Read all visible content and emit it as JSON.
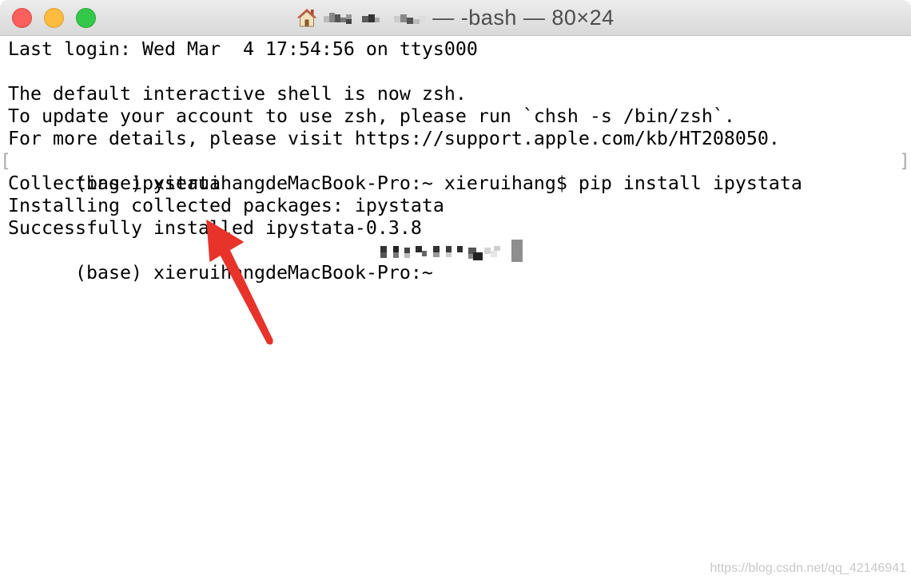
{
  "window": {
    "title": "— -bash — 80×24"
  },
  "icons": {
    "title_icon": "home-icon"
  },
  "terminal": {
    "lines": [
      "Last login: Wed Mar  4 17:54:56 on ttys000",
      "",
      "The default interactive shell is now zsh.",
      "To update your account to use zsh, please run `chsh -s /bin/zsh`.",
      "For more details, please visit https://support.apple.com/kb/HT208050.",
      "(base) xieruihangdeMacBook-Pro:~ xieruihang$ pip install ipystata",
      "Collecting ipystata",
      "Installing collected packages: ipystata",
      "Successfully installed ipystata-0.3.8",
      "(base) xieruihangdeMacBook-Pro:~"
    ],
    "mark_open": "[",
    "mark_close": "]"
  },
  "watermark": "https://blog.csdn.net/qq_42146941",
  "colors": {
    "close_button": "#fc605c",
    "minimize_button": "#fdbc40",
    "zoom_button": "#34c84a",
    "annotation_arrow": "#e8332b",
    "cursor": "#8e8e8e"
  }
}
